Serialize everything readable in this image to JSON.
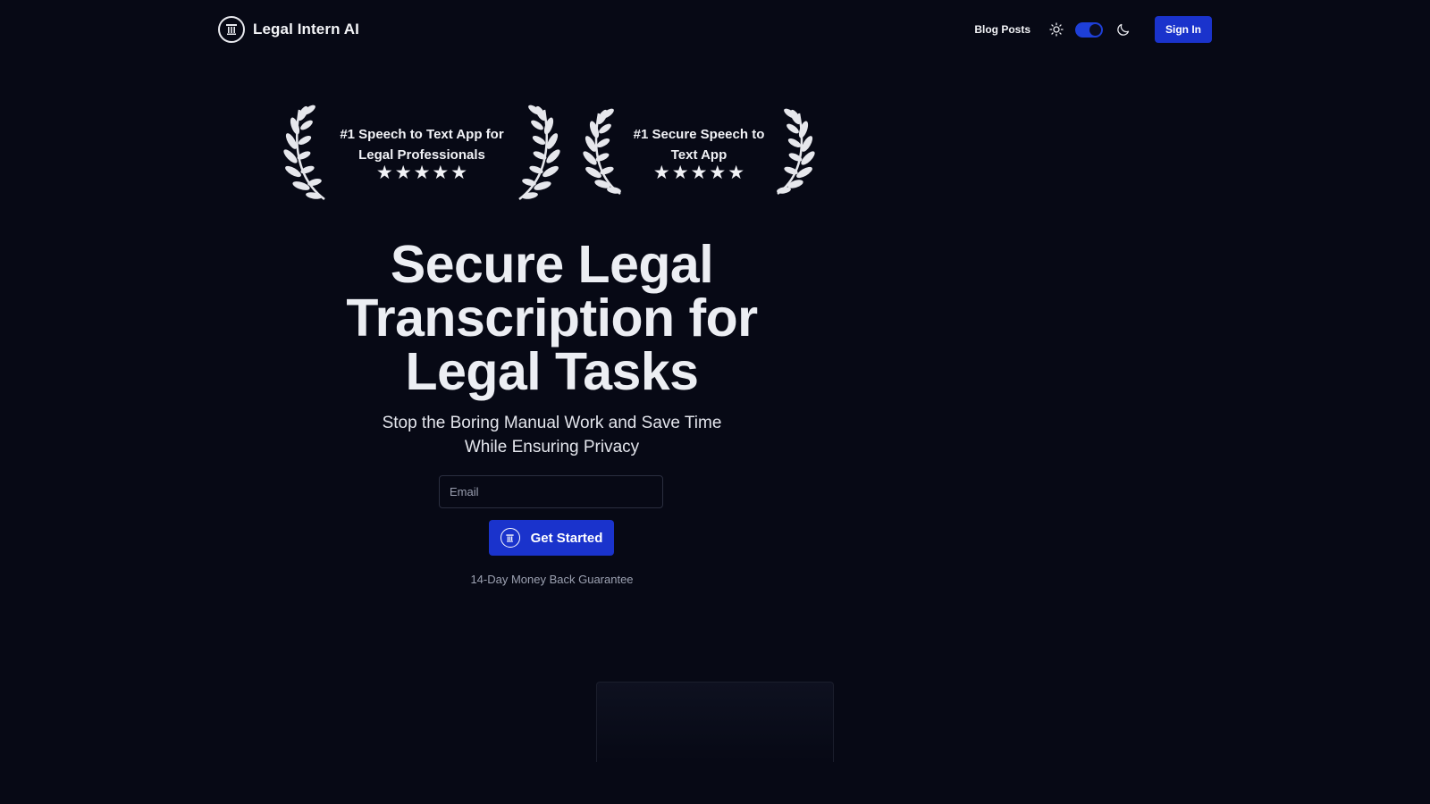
{
  "header": {
    "brand_name": "Legal Intern AI",
    "brand_icon": "pillar-logo-icon",
    "nav": {
      "blog_label": "Blog Posts",
      "theme_light_icon": "sun-icon",
      "theme_dark_icon": "moon-icon",
      "sign_in_label": "Sign In"
    }
  },
  "awards": [
    {
      "text": "#1 Speech to Text App for Legal Professionals",
      "stars": 5
    },
    {
      "text": "#1 Secure Speech to Text App",
      "stars": 5
    }
  ],
  "hero": {
    "title": "Secure Legal Transcription for Legal Tasks",
    "subtitle": "Stop the Boring Manual Work and Save Time While Ensuring Privacy",
    "email_placeholder": "Email",
    "cta_label": "Get Started",
    "guarantee": "14-Day Money Back Guarantee"
  },
  "colors": {
    "background": "#070915",
    "accent": "#1a33cc",
    "text": "#e8e9ee",
    "muted": "#9ca1b1"
  }
}
